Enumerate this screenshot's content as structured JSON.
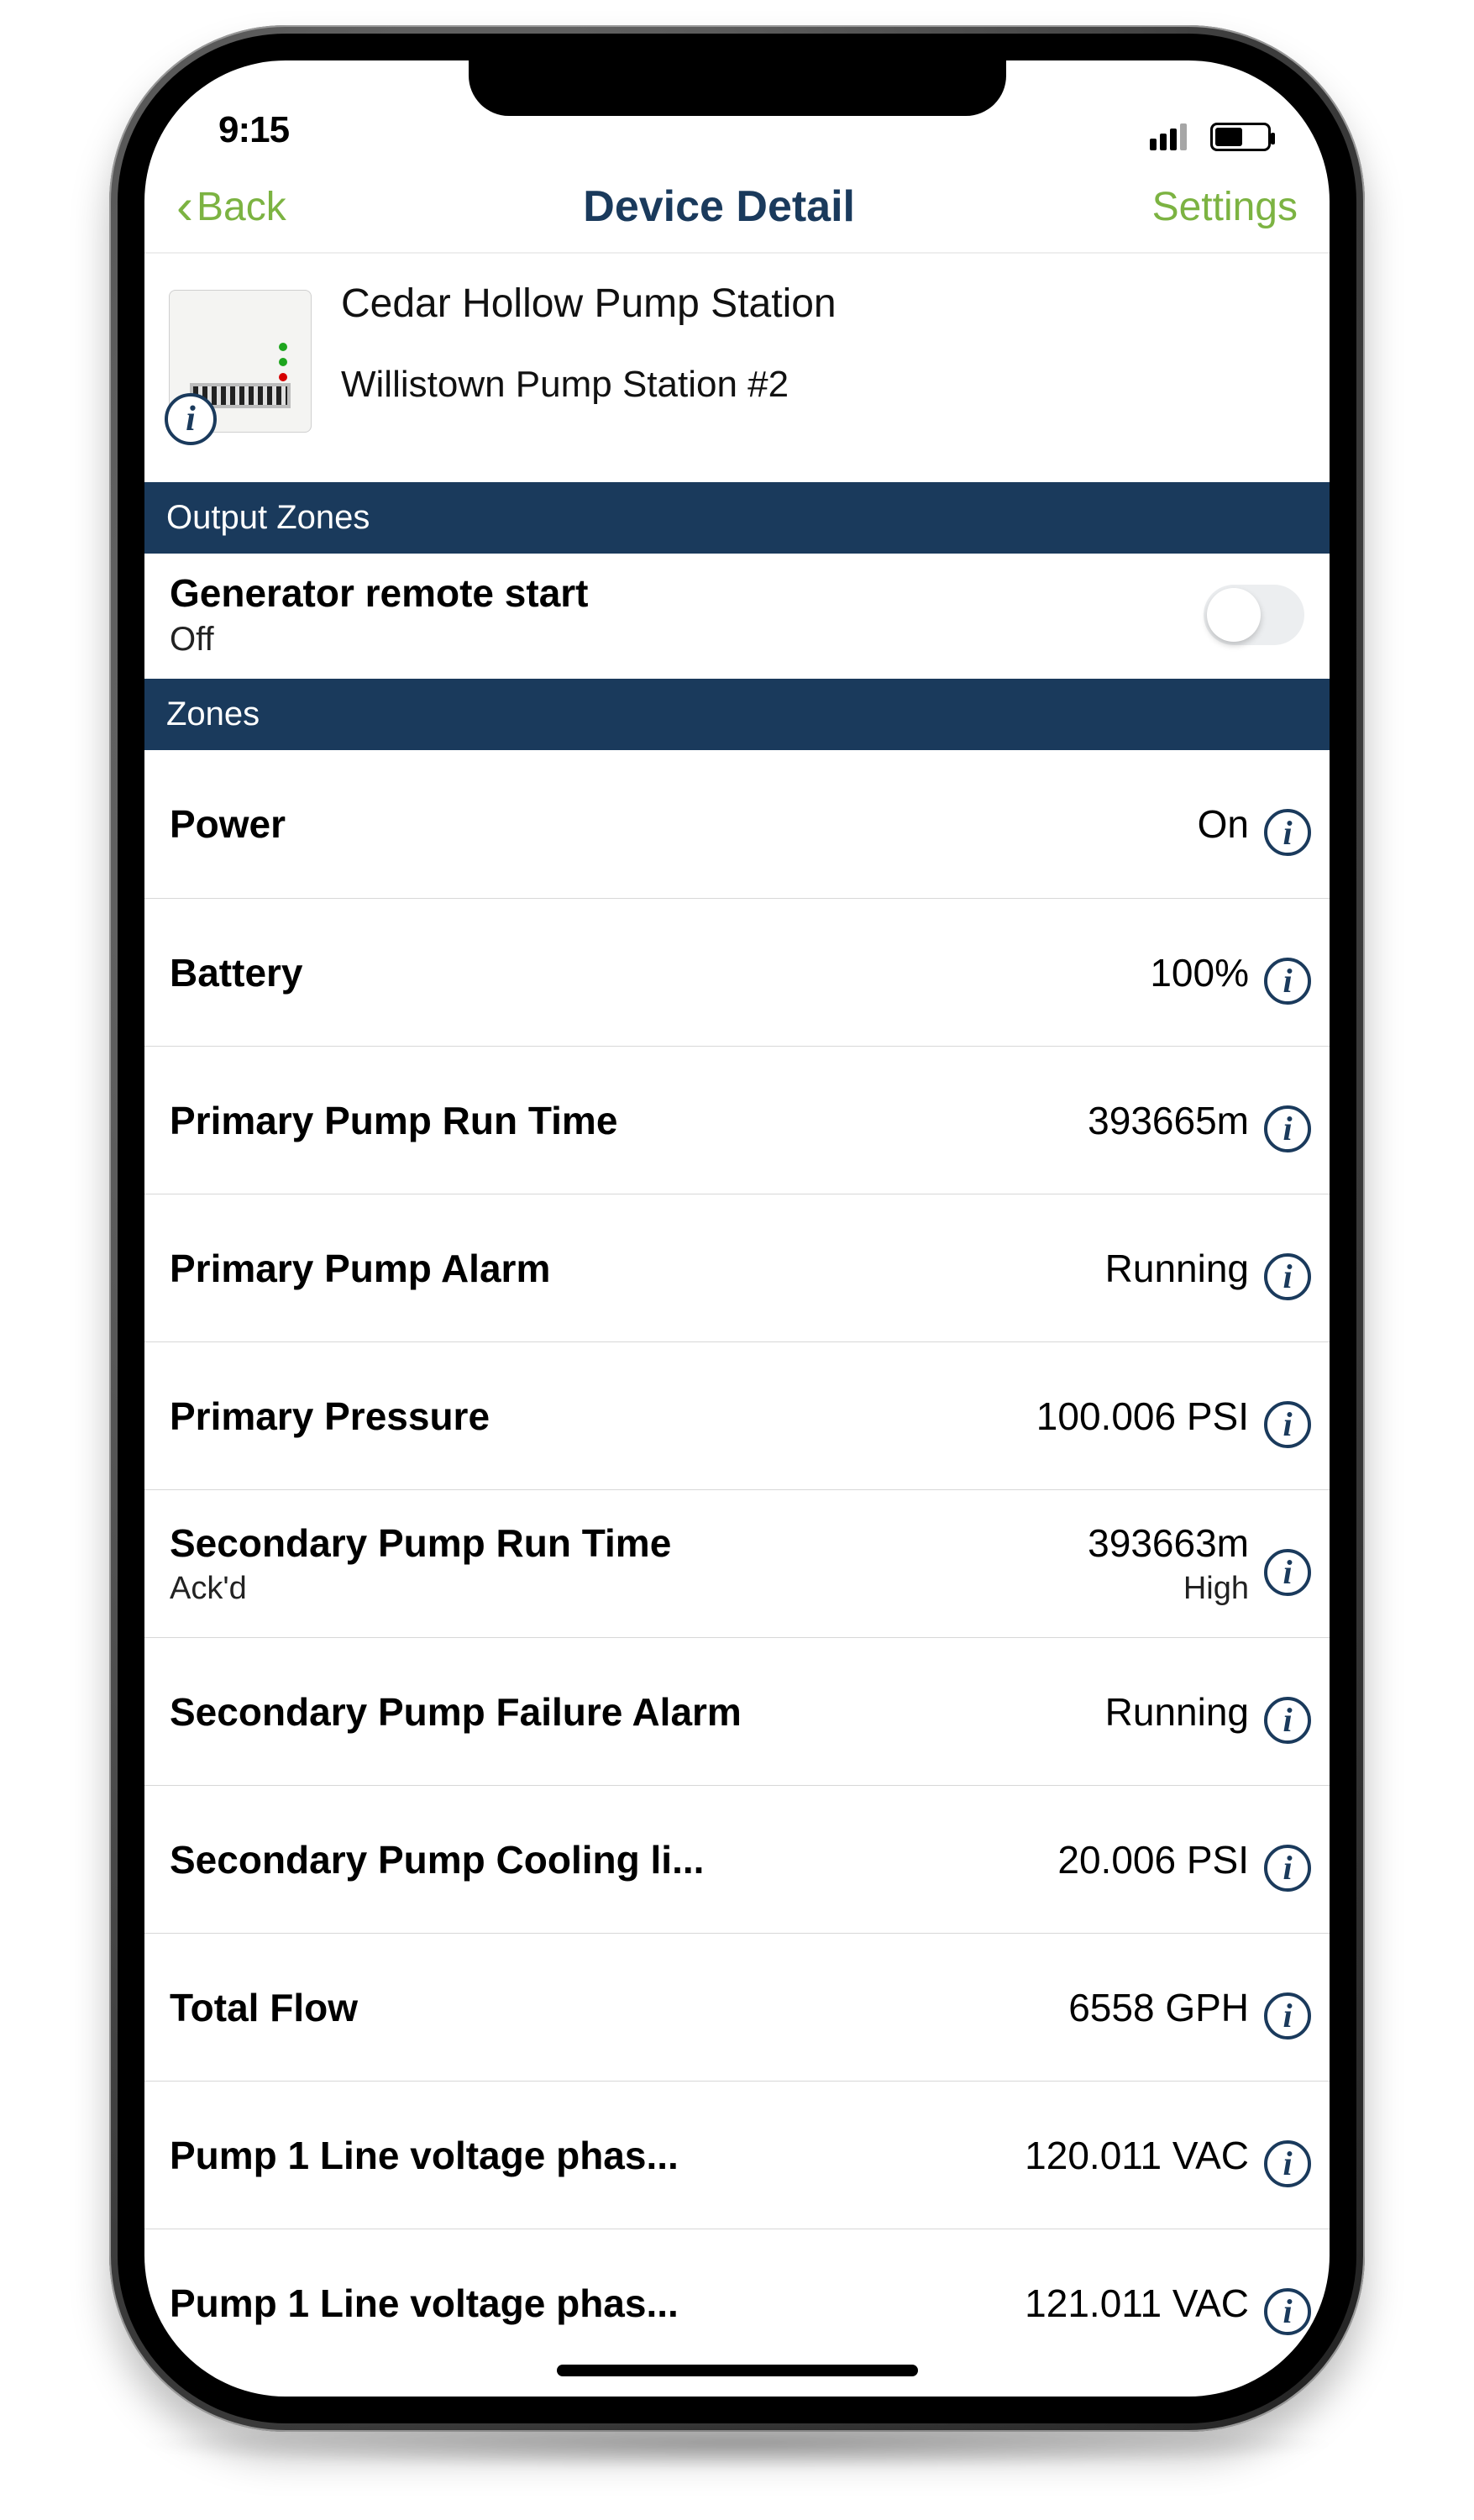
{
  "status": {
    "time": "9:15"
  },
  "nav": {
    "back_label": "Back",
    "title": "Device Detail",
    "settings_label": "Settings"
  },
  "device": {
    "title": "Cedar Hollow Pump Station",
    "subtitle": "Willistown Pump Station #2"
  },
  "sections": {
    "output_zones": "Output Zones",
    "zones": "Zones"
  },
  "output": {
    "label": "Generator remote start",
    "state": "Off",
    "on": false
  },
  "zones": [
    {
      "label": "Power",
      "value": "On"
    },
    {
      "label": "Battery",
      "value": "100%"
    },
    {
      "label": "Primary Pump Run Time",
      "value": "393665m"
    },
    {
      "label": "Primary Pump Alarm",
      "value": "Running"
    },
    {
      "label": "Primary Pressure",
      "value": "100.006 PSI"
    },
    {
      "label": "Secondary Pump Run Time",
      "value": "393663m",
      "sublabel": "Ack'd",
      "subvalue": "High"
    },
    {
      "label": "Secondary Pump Failure Alarm",
      "value": "Running"
    },
    {
      "label": "Secondary Pump Cooling li...",
      "value": "20.006 PSI"
    },
    {
      "label": "Total Flow",
      "value": "6558 GPH"
    },
    {
      "label": "Pump 1 Line voltage phas...",
      "value": "120.011 VAC"
    },
    {
      "label": "Pump 1 Line voltage phas...",
      "value": "121.011 VAC"
    }
  ]
}
